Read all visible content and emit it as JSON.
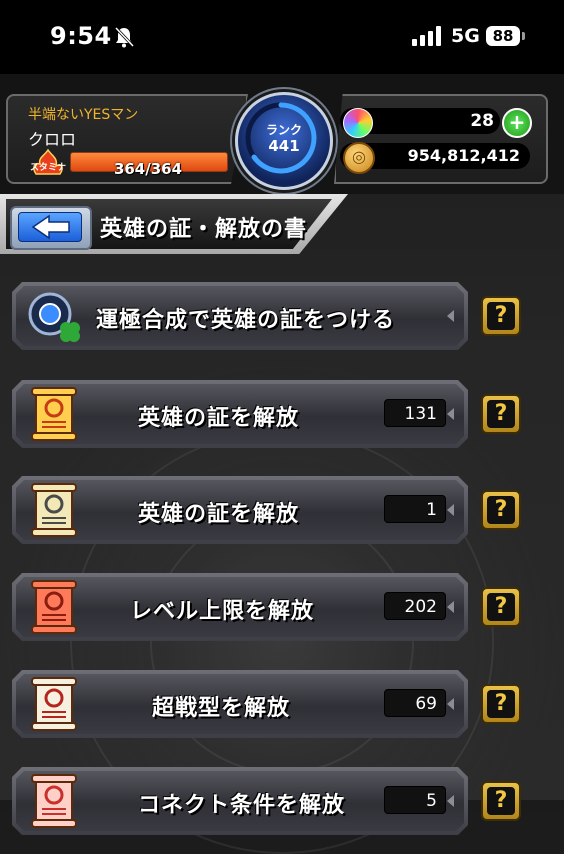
{
  "status_bar": {
    "time": "9:54",
    "network": "5G",
    "battery": "88",
    "icons": [
      "bell-muted-icon",
      "signal-icon"
    ]
  },
  "player": {
    "name": "半端ないYESマン",
    "sub_name": "クロロ",
    "stamina_label": "スタミナ",
    "stamina_text": "364/364",
    "stamina_fraction": 1.0
  },
  "rank": {
    "label": "ランク",
    "value": "441"
  },
  "currency": {
    "orbs": "28",
    "coins": "954,812,412",
    "plus_label": "+"
  },
  "title": {
    "text": "英雄の証・解放の書"
  },
  "menu": [
    {
      "label": "運極合成で英雄の証をつける",
      "count": "",
      "icon": "clover-ring-icon"
    },
    {
      "label": "英雄の証を解放",
      "count": "131",
      "icon": "gold-scroll-icon"
    },
    {
      "label": "英雄の証を解放",
      "count": "1",
      "icon": "silver-scroll-icon"
    },
    {
      "label": "レベル上限を解放",
      "count": "202",
      "icon": "red-scroll-icon"
    },
    {
      "label": "超戦型を解放",
      "count": "69",
      "icon": "white-scroll-icon"
    },
    {
      "label": "コネクト条件を解放",
      "count": "5",
      "icon": "pink-scroll-icon"
    }
  ],
  "help_label": "?",
  "colors": {
    "accent_gold": "#f2b52a",
    "stamina_orange": "#ff8a3c",
    "rank_blue": "#1c5fd9",
    "help_gold": "#e8c14a"
  }
}
